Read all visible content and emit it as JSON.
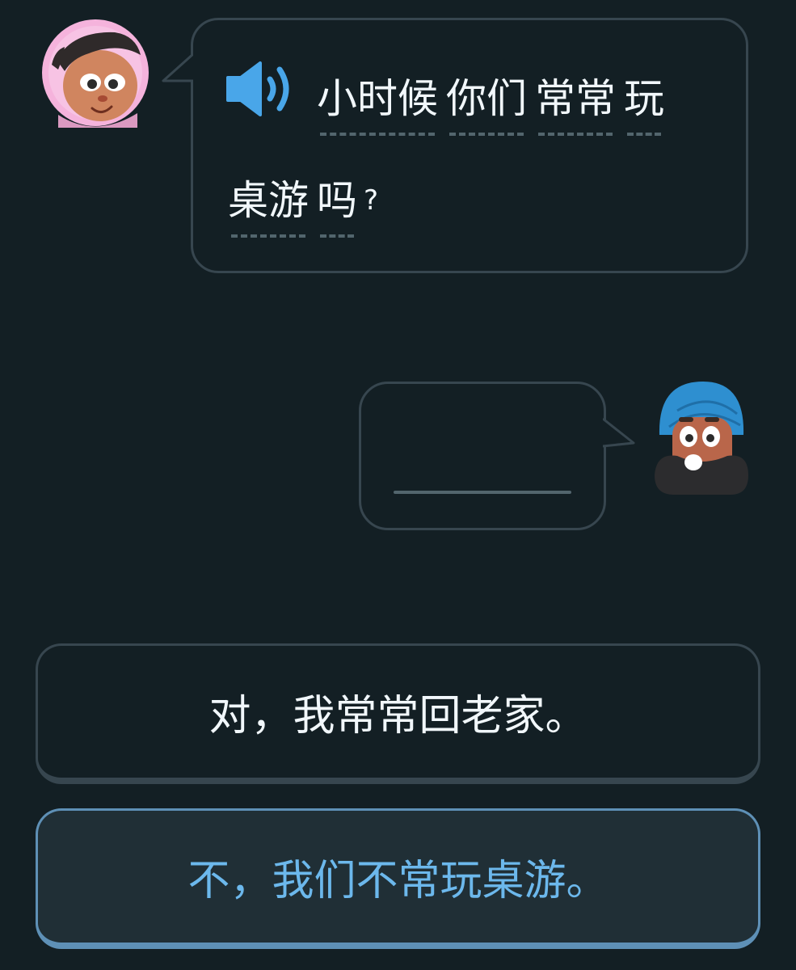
{
  "prompt": {
    "words_line1": [
      "小时候",
      "你们",
      "常常",
      "玩"
    ],
    "words_line2": [
      "桌游",
      "吗"
    ],
    "punctuation": "?",
    "audio_icon": "speaker-icon"
  },
  "characters": {
    "speaker_icon": "avatar-woman-pink-hijab",
    "responder_icon": "avatar-man-blue-turban"
  },
  "answer": {
    "value": ""
  },
  "choices": [
    {
      "label": "对，我常常回老家。",
      "selected": false
    },
    {
      "label": "不，我们不常玩桌游。",
      "selected": true
    }
  ],
  "colors": {
    "background": "#131f24",
    "border": "#37464f",
    "selected_border": "#5e90b6",
    "selected_text": "#6cb8ec",
    "accent_blue": "#49a6e9"
  }
}
